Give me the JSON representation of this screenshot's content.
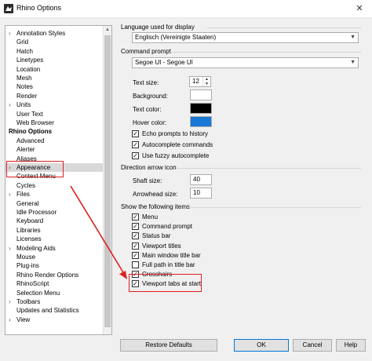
{
  "window": {
    "title": "Rhino Options",
    "close_glyph": "✕"
  },
  "tree": {
    "items": [
      {
        "label": "Annotation Styles",
        "expander": "›",
        "kind": "child"
      },
      {
        "label": "Grid",
        "expander": "",
        "kind": "child"
      },
      {
        "label": "Hatch",
        "expander": "",
        "kind": "child"
      },
      {
        "label": "Linetypes",
        "expander": "",
        "kind": "child"
      },
      {
        "label": "Location",
        "expander": "",
        "kind": "child"
      },
      {
        "label": "Mesh",
        "expander": "",
        "kind": "child"
      },
      {
        "label": "Notes",
        "expander": "",
        "kind": "child"
      },
      {
        "label": "Render",
        "expander": "",
        "kind": "child"
      },
      {
        "label": "Units",
        "expander": "›",
        "kind": "child"
      },
      {
        "label": "User Text",
        "expander": "",
        "kind": "child"
      },
      {
        "label": "Web Browser",
        "expander": "",
        "kind": "child"
      },
      {
        "label": "Rhino Options",
        "expander": "",
        "kind": "root"
      },
      {
        "label": "Advanced",
        "expander": "",
        "kind": "child"
      },
      {
        "label": "Alerter",
        "expander": "",
        "kind": "child"
      },
      {
        "label": "Aliases",
        "expander": "",
        "kind": "child"
      },
      {
        "label": "Appearance",
        "expander": "›",
        "kind": "child",
        "selected": true
      },
      {
        "label": "Context Menu",
        "expander": "",
        "kind": "child"
      },
      {
        "label": "Cycles",
        "expander": "",
        "kind": "child"
      },
      {
        "label": "Files",
        "expander": "›",
        "kind": "child"
      },
      {
        "label": "General",
        "expander": "",
        "kind": "child"
      },
      {
        "label": "Idle Processor",
        "expander": "",
        "kind": "child"
      },
      {
        "label": "Keyboard",
        "expander": "",
        "kind": "child"
      },
      {
        "label": "Libraries",
        "expander": "",
        "kind": "child"
      },
      {
        "label": "Licenses",
        "expander": "",
        "kind": "child"
      },
      {
        "label": "Modeling Aids",
        "expander": "›",
        "kind": "child"
      },
      {
        "label": "Mouse",
        "expander": "",
        "kind": "child"
      },
      {
        "label": "Plug-ins",
        "expander": "",
        "kind": "child"
      },
      {
        "label": "Rhino Render Options",
        "expander": "",
        "kind": "child"
      },
      {
        "label": "RhinoScript",
        "expander": "",
        "kind": "child"
      },
      {
        "label": "Selection Menu",
        "expander": "",
        "kind": "child"
      },
      {
        "label": "Toolbars",
        "expander": "›",
        "kind": "child"
      },
      {
        "label": "Updates and Statistics",
        "expander": "",
        "kind": "child"
      },
      {
        "label": "View",
        "expander": "›",
        "kind": "child"
      }
    ]
  },
  "language": {
    "heading": "Language used for display",
    "value": "Englisch (Vereinigte Staaten)"
  },
  "command_prompt": {
    "heading": "Command prompt",
    "font_value": "Segoe UI - Segoe UI",
    "text_size_label": "Text size:",
    "text_size_value": "12",
    "background_label": "Background:",
    "background_color": "#ffffff",
    "text_color_label": "Text color:",
    "text_color": "#000000",
    "hover_color_label": "Hover color:",
    "hover_color": "#1a78d6",
    "checks": [
      {
        "label": "Echo prompts to history",
        "checked": true
      },
      {
        "label": "Autocomplete commands",
        "checked": true
      },
      {
        "label": "Use fuzzy autocomplete",
        "checked": true
      }
    ]
  },
  "direction_arrow": {
    "heading": "Direction arrow icon",
    "shaft_label": "Shaft size:",
    "shaft_value": "40",
    "arrowhead_label": "Arrowhead size:",
    "arrowhead_value": "10"
  },
  "show_items": {
    "heading": "Show the following items",
    "checks": [
      {
        "label": "Menu",
        "checked": true
      },
      {
        "label": "Command prompt",
        "checked": true
      },
      {
        "label": "Status bar",
        "checked": true
      },
      {
        "label": "Viewport titles",
        "checked": true
      },
      {
        "label": "Main window title bar",
        "checked": true
      },
      {
        "label": "Full path in title bar",
        "checked": false
      },
      {
        "label": "Crosshairs",
        "checked": true
      },
      {
        "label": "Viewport tabs at start",
        "checked": true
      }
    ]
  },
  "buttons": {
    "restore": "Restore Defaults",
    "ok": "OK",
    "cancel": "Cancel",
    "help": "Help"
  },
  "checkmark_glyph": "✓",
  "annotation_color": "#e02020"
}
